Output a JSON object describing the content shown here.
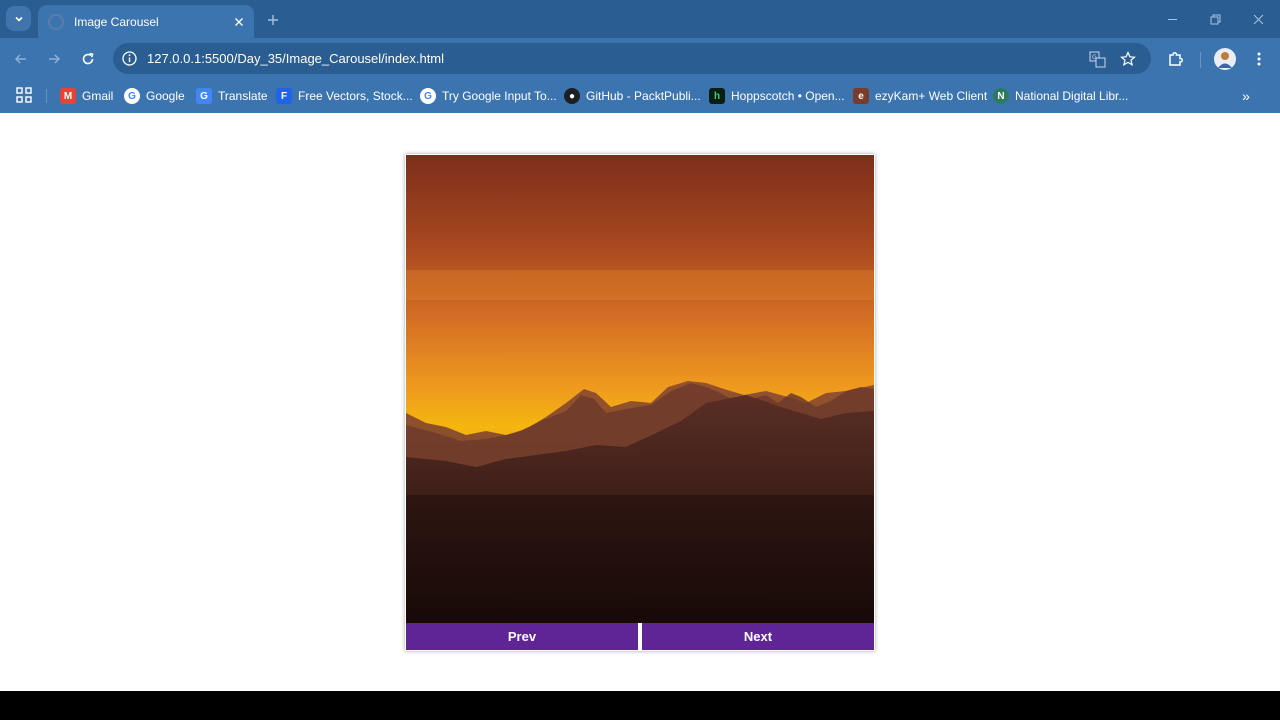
{
  "browser": {
    "tab": {
      "title": "Image Carousel"
    },
    "address": {
      "url": "127.0.0.1:5500/Day_35/Image_Carousel/index.html"
    },
    "bookmarks": [
      {
        "label": "Gmail",
        "icon": "gmail-icon"
      },
      {
        "label": "Google",
        "icon": "google-icon"
      },
      {
        "label": "Translate",
        "icon": "translate-icon"
      },
      {
        "label": "Free Vectors, Stock...",
        "icon": "freepik-icon"
      },
      {
        "label": "Try Google Input To...",
        "icon": "google-icon"
      },
      {
        "label": "GitHub - PacktPubli...",
        "icon": "github-icon"
      },
      {
        "label": "Hoppscotch • Open...",
        "icon": "hoppscotch-icon"
      },
      {
        "label": "ezyKam+ Web Client",
        "icon": "ezykam-icon"
      },
      {
        "label": "National Digital Libr...",
        "icon": "ndl-icon"
      }
    ],
    "bookmarks_more": "»"
  },
  "carousel": {
    "prev_label": "Prev",
    "next_label": "Next",
    "colors": {
      "button": "#5f2597"
    }
  }
}
